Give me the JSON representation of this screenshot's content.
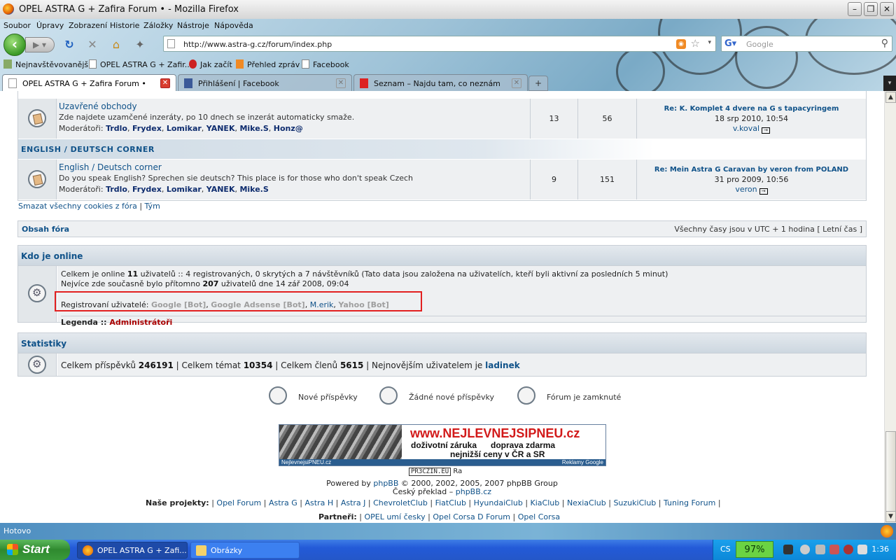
{
  "window": {
    "title": "OPEL ASTRA G + Zafira Forum • - Mozilla Firefox"
  },
  "menu": [
    "Soubor",
    "Úpravy",
    "Zobrazení",
    "Historie",
    "Záložky",
    "Nástroje",
    "Nápověda"
  ],
  "url": "http://www.astra-g.cz/forum/index.php",
  "search_placeholder": "Google",
  "bookmarks": [
    "Nejnavštěvovanější",
    "OPEL ASTRA G + Zafir...",
    "Jak začít",
    "Přehled zpráv",
    "Facebook"
  ],
  "tabs": [
    {
      "label": "OPEL ASTRA G + Zafira Forum •",
      "active": true
    },
    {
      "label": "Přihlášení | Facebook",
      "active": false
    },
    {
      "label": "Seznam – Najdu tam, co neznám",
      "active": false
    }
  ],
  "forums": [
    {
      "name": "Uzavřené obchody",
      "desc": "Zde najdete uzamčené inzeráty, po 10 dnech se inzerát automaticky smaže.",
      "mods_label": "Moderátoři:",
      "mods": [
        "Trdlo",
        "Frydex",
        "Lomikar",
        "YANEK",
        "Mike.S",
        "Honz@"
      ],
      "topics": "13",
      "posts": "56",
      "last_title": "Re: K. Komplet 4 dvere na G s tapacyringem",
      "last_date": "18 srp 2010, 10:54",
      "last_author": "v.koval"
    },
    {
      "name": "English / Deutsch corner",
      "desc": "Do you speak English? Sprechen sie deutsch? This place is for those who don't speak Czech",
      "mods_label": "Moderátoři:",
      "mods": [
        "Trdlo",
        "Frydex",
        "Lomikar",
        "YANEK",
        "Mike.S"
      ],
      "topics": "9",
      "posts": "151",
      "last_title": "Re: Mein Astra G Caravan by veron from POLAND",
      "last_date": "31 pro 2009, 10:56",
      "last_author": "veron"
    }
  ],
  "category": "ENGLISH / DEUTSCH CORNER",
  "links": {
    "cookies": "Smazat všechny cookies z fóra",
    "team": "Tým"
  },
  "navbar": {
    "left": "Obsah fóra",
    "right": "Všechny časy jsou v UTC + 1 hodina [ Letní čas ]"
  },
  "online": {
    "title": "Kdo je online",
    "line1_a": "Celkem je online ",
    "line1_count": "11",
    "line1_b": " uživatelů :: 4 registrovaných, 0 skrytých a 7 návštěvníků (Tato data jsou založena na uživatelích, kteří byli aktivní za posledních 5 minut)",
    "line2_a": "Nejvíce zde současně bylo přítomno ",
    "line2_count": "207",
    "line2_b": " uživatelů dne 14 zář 2008, 09:04",
    "reg_label": "Registrovaní uživatelé: ",
    "users": [
      "Google [Bot]",
      "Google Adsense [Bot]",
      "M.erik",
      "Yahoo [Bot]"
    ],
    "legend_label": "Legenda :: ",
    "legend_admin": "Administrátoři"
  },
  "stats": {
    "title": "Statistiky",
    "posts_label": "Celkem příspěvků ",
    "posts": "246191",
    "topics_label": "Celkem témat ",
    "topics": "10354",
    "members_label": "Celkem členů ",
    "members": "5615",
    "newest_label": "Nejnovějším uživatelem je ",
    "newest": "ladinek"
  },
  "icon_legend": [
    "Nové příspěvky",
    "Žádné nové příspěvky",
    "Fórum je zamknuté"
  ],
  "ad": {
    "line1": "www.NEJLEVNEJSIPNEU.cz",
    "line2": "doživotní záruka      doprava zdarma",
    "line3": "nejnižší ceny v ČR a SR",
    "foot_left": "NejlevnejsiPNEU.cz",
    "foot_right": "Reklamy Google"
  },
  "counter": {
    "text": "PR3CZIN.EU",
    "suffix": "Ra"
  },
  "footer": {
    "powered_a": "Powered by ",
    "powered_link": "phpBB",
    "powered_b": " © 2000, 2002, 2005, 2007 phpBB Group",
    "czech_a": "Český překlad – ",
    "czech_link": "phpBB.cz",
    "projects_label": "Naše projekty:",
    "projects": [
      "Opel Forum",
      "Astra G",
      "Astra H",
      "Astra J",
      "ChevroletClub",
      "FiatClub",
      "HyundaiClub",
      "KiaClub",
      "NexiaClub",
      "SuzukiClub",
      "Tuning Forum"
    ],
    "partners_label": "Partneři:",
    "partners": [
      "OPEL umí česky",
      "Opel Corsa D Forum",
      "Opel Corsa"
    ]
  },
  "status": "Hotovo",
  "taskbar": {
    "start": "Start",
    "tasks": [
      "OPEL ASTRA G + Zafi...",
      "Obrázky"
    ],
    "lang": "CS",
    "battery": "97%",
    "clock": "1:36"
  }
}
